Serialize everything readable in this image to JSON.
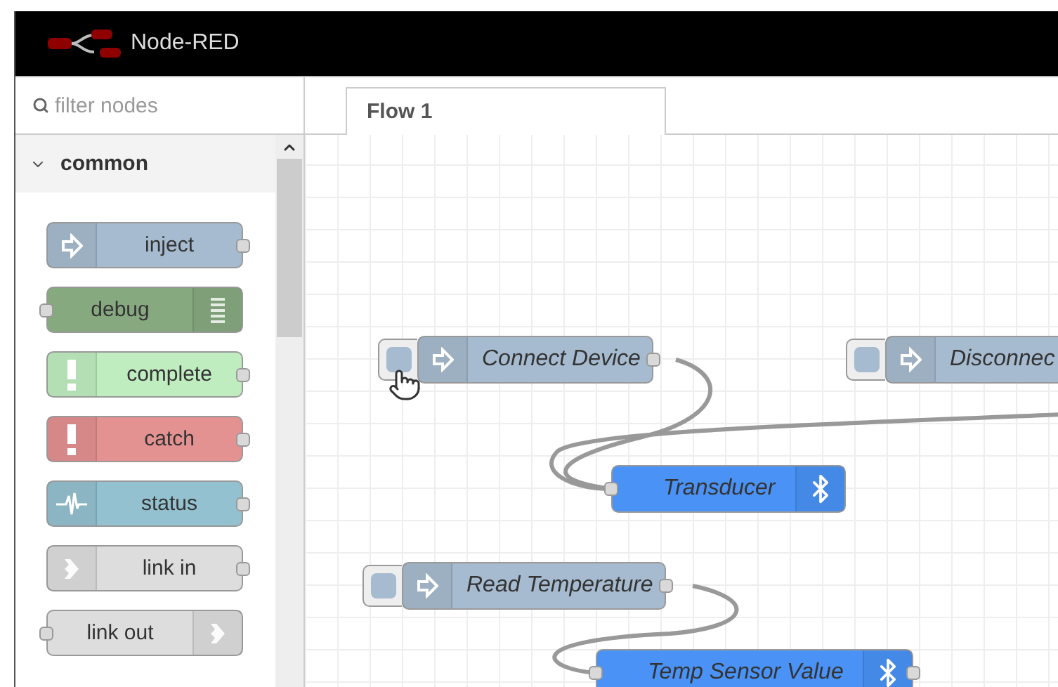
{
  "header": {
    "title": "Node-RED"
  },
  "palette": {
    "filter": {
      "placeholder": "filter nodes"
    },
    "category": {
      "label": "common",
      "expanded": true
    },
    "nodes": [
      {
        "label": "inject",
        "kind": "inject",
        "color": "#a6bbcf"
      },
      {
        "label": "debug",
        "kind": "debug",
        "color": "#87a980"
      },
      {
        "label": "complete",
        "kind": "complete",
        "color": "#c0edc0"
      },
      {
        "label": "catch",
        "kind": "catch",
        "color": "#e49191"
      },
      {
        "label": "status",
        "kind": "status",
        "color": "#94c1d0"
      },
      {
        "label": "link in",
        "kind": "linkin",
        "color": "#dddddd"
      },
      {
        "label": "link out",
        "kind": "linkout",
        "color": "#dddddd"
      }
    ]
  },
  "tabs": [
    {
      "label": "Flow 1",
      "selected": true
    }
  ],
  "canvas": {
    "nodes": [
      {
        "label": "Connect Device",
        "kind": "inject"
      },
      {
        "label": "Disconnec",
        "kind": "inject"
      },
      {
        "label": "Transducer",
        "kind": "ble"
      },
      {
        "label": "Read Temperature",
        "kind": "inject"
      },
      {
        "label": "Temp Sensor Value",
        "kind": "ble"
      }
    ]
  }
}
